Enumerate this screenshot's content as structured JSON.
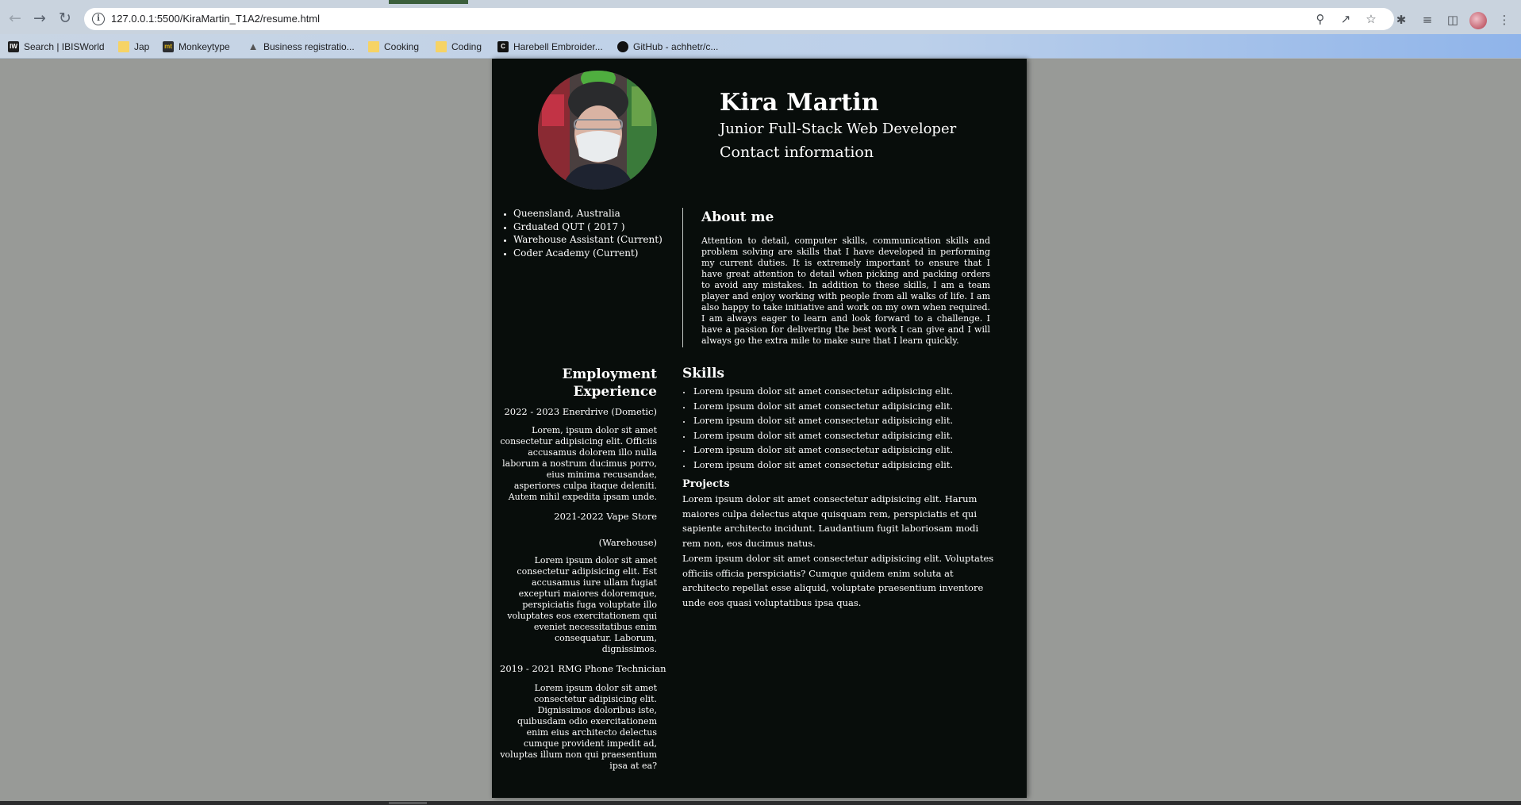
{
  "browser": {
    "url": "127.0.0.1:5500/KiraMartin_T1A2/resume.html",
    "bookmarks": [
      {
        "label": "Search | IBISWorld",
        "icon": "ibisworld-icon"
      },
      {
        "label": "Jap",
        "icon": "folder-icon"
      },
      {
        "label": "Monkeytype",
        "icon": "monkeytype-icon"
      },
      {
        "label": "Business registratio...",
        "icon": "cake-icon"
      },
      {
        "label": "Cooking",
        "icon": "folder-icon"
      },
      {
        "label": "Coding",
        "icon": "folder-icon"
      },
      {
        "label": "Harebell Embroider...",
        "icon": "c-icon"
      },
      {
        "label": "GitHub - achhetr/c...",
        "icon": "github-icon"
      }
    ]
  },
  "resume": {
    "name": "Kira Martin",
    "title": "Junior Full-Stack Web Developer",
    "contact_heading": "Contact information",
    "facts": [
      "Queensland, Australia",
      "Grduated QUT ( 2017 )",
      "Warehouse Assistant (Current)",
      "Coder Academy (Current)"
    ],
    "about_heading": "About me",
    "about_text": "Attention to detail, computer skills, communication skills and problem solving are skills that I have developed in performing my current duties. It is extremely important to ensure that I have great attention to detail when picking and packing orders to avoid any mistakes. In addition to these skills, I am a team player and enjoy working with people from all walks of life. I am also happy to take initiative and work on my own when required. I am always eager to learn and look forward to a challenge. I have a passion for delivering the best work I can give and I will always go the extra mile to make sure that I learn quickly.",
    "employment_heading": "Employment Experience",
    "jobs": [
      {
        "title": "2022 - 2023 Enerdrive (Dometic)",
        "subtitle": "",
        "text": "Lorem, ipsum dolor sit amet consectetur adipisicing elit. Officiis accusamus dolorem illo nulla laborum a nostrum ducimus porro, eius minima recusandae, asperiores culpa itaque deleniti. Autem nihil expedita ipsam unde."
      },
      {
        "title": "2021-2022 Vape Store",
        "subtitle": "(Warehouse)",
        "text": "Lorem ipsum dolor sit amet consectetur adipisicing elit. Est accusamus iure ullam fugiat excepturi maiores doloremque, perspiciatis fuga voluptate illo voluptates eos exercitationem qui eveniet necessitatibus enim consequatur. Laborum, dignissimos."
      },
      {
        "title": "2019 - 2021 RMG Phone Technician",
        "subtitle": "",
        "text": "Lorem ipsum dolor sit amet consectetur adipisicing elit. Dignissimos doloribus iste, quibusdam odio exercitationem enim eius architecto delectus cumque provident impedit ad, voluptas illum non qui praesentium ipsa at ea?"
      }
    ],
    "skills_heading": "Skills",
    "skills": [
      "Lorem ipsum dolor sit amet consectetur adipisicing elit.",
      "Lorem ipsum dolor sit amet consectetur adipisicing elit.",
      "Lorem ipsum dolor sit amet consectetur adipisicing elit.",
      "Lorem ipsum dolor sit amet consectetur adipisicing elit.",
      "Lorem ipsum dolor sit amet consectetur adipisicing elit.",
      "Lorem ipsum dolor sit amet consectetur adipisicing elit."
    ],
    "projects_heading": "Projects",
    "projects": [
      "Lorem ipsum dolor sit amet consectetur adipisicing elit. Harum maiores culpa delectus atque quisquam rem, perspiciatis et qui sapiente architecto incidunt. Laudantium fugit laboriosam modi rem non, eos ducimus natus.",
      "Lorem ipsum dolor sit amet consectetur adipisicing elit. Voluptates officiis officia perspiciatis? Cumque quidem enim soluta at architecto repellat esse aliquid, voluptate praesentium inventore unde eos quasi voluptatibus ipsa quas."
    ]
  },
  "colors": {
    "page_background": "#989a97",
    "resume_background": "#080d0b",
    "text": "#ffffff"
  }
}
